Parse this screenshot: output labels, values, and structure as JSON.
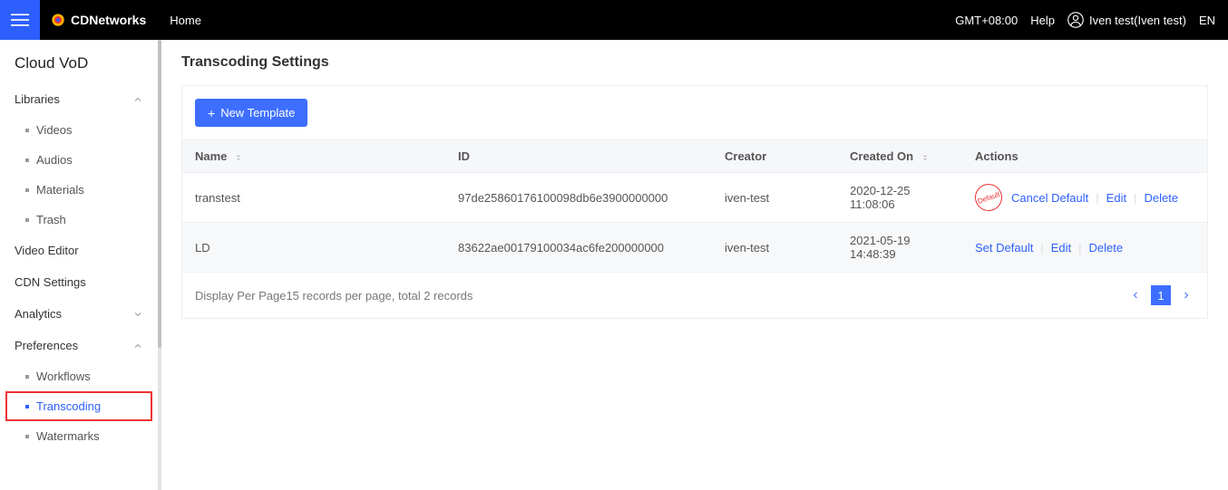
{
  "topbar": {
    "brand": "CDNetworks",
    "home": "Home",
    "timezone": "GMT+08:00",
    "help": "Help",
    "user": "Iven test(Iven test)",
    "lang": "EN"
  },
  "sidebar": {
    "product": "Cloud VoD",
    "groups": {
      "libraries": "Libraries",
      "analytics": "Analytics",
      "preferences": "Preferences"
    },
    "libraries_items": {
      "videos": "Videos",
      "audios": "Audios",
      "materials": "Materials",
      "trash": "Trash"
    },
    "simple": {
      "video_editor": "Video Editor",
      "cdn_settings": "CDN Settings"
    },
    "preferences_items": {
      "workflows": "Workflows",
      "transcoding": "Transcoding",
      "watermarks": "Watermarks"
    }
  },
  "page": {
    "title": "Transcoding Settings",
    "new_template": "New Template"
  },
  "table": {
    "headers": {
      "name": "Name",
      "id": "ID",
      "creator": "Creator",
      "created_on": "Created On",
      "actions": "Actions"
    },
    "rows": [
      {
        "name": "transtest",
        "id": "97de25860176100098db6e3900000000",
        "creator": "iven-test",
        "created_on": "2020-12-25 11:08:06",
        "is_default": true
      },
      {
        "name": "LD",
        "id": "83622ae00179100034ac6fe200000000",
        "creator": "iven-test",
        "created_on": "2021-05-19 14:48:39",
        "is_default": false
      }
    ],
    "actions": {
      "cancel_default": "Cancel Default",
      "set_default": "Set Default",
      "edit": "Edit",
      "delete": "Delete",
      "default_badge": "Default"
    },
    "footer": "Display Per Page15 records per page, total 2 records",
    "page_number": "1"
  }
}
